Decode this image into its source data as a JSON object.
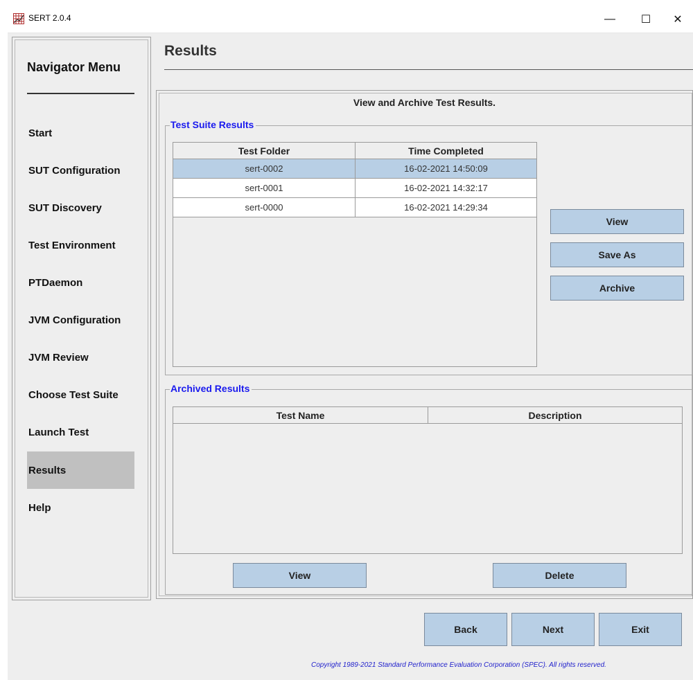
{
  "window": {
    "title": "SERT 2.0.4"
  },
  "titlebar": {
    "minimize": "—",
    "maximize": "☐",
    "close": "✕"
  },
  "sidebar": {
    "title": "Navigator Menu",
    "items": [
      {
        "label": "Start"
      },
      {
        "label": "SUT Configuration"
      },
      {
        "label": "SUT Discovery"
      },
      {
        "label": "Test Environment"
      },
      {
        "label": "PTDaemon"
      },
      {
        "label": "JVM Configuration"
      },
      {
        "label": "JVM Review"
      },
      {
        "label": "Choose Test Suite"
      },
      {
        "label": "Launch Test"
      },
      {
        "label": "Results",
        "active": true
      },
      {
        "label": "Help"
      }
    ]
  },
  "header": {
    "title": "Results"
  },
  "main": {
    "heading": "View and Archive Test Results.",
    "suite_results": {
      "legend": "Test Suite Results",
      "columns": [
        "Test Folder",
        "Time Completed"
      ],
      "rows": [
        {
          "folder": "sert-0002",
          "time": "16-02-2021 14:50:09",
          "selected": true
        },
        {
          "folder": "sert-0001",
          "time": "16-02-2021 14:32:17"
        },
        {
          "folder": "sert-0000",
          "time": "16-02-2021 14:29:34"
        }
      ],
      "buttons": {
        "view": "View",
        "save_as": "Save As",
        "archive": "Archive"
      }
    },
    "archived": {
      "legend": "Archived Results",
      "columns": [
        "Test Name",
        "Description"
      ],
      "buttons": {
        "view": "View",
        "delete": "Delete"
      }
    }
  },
  "footer": {
    "back": "Back",
    "next": "Next",
    "exit": "Exit",
    "copyright": "Copyright 1989-2021 Standard Performance Evaluation Corporation (SPEC). All rights reserved."
  },
  "colors": {
    "selection": "#b8cfe5",
    "legend": "#1a1aee",
    "button": "#b8cfe5"
  }
}
